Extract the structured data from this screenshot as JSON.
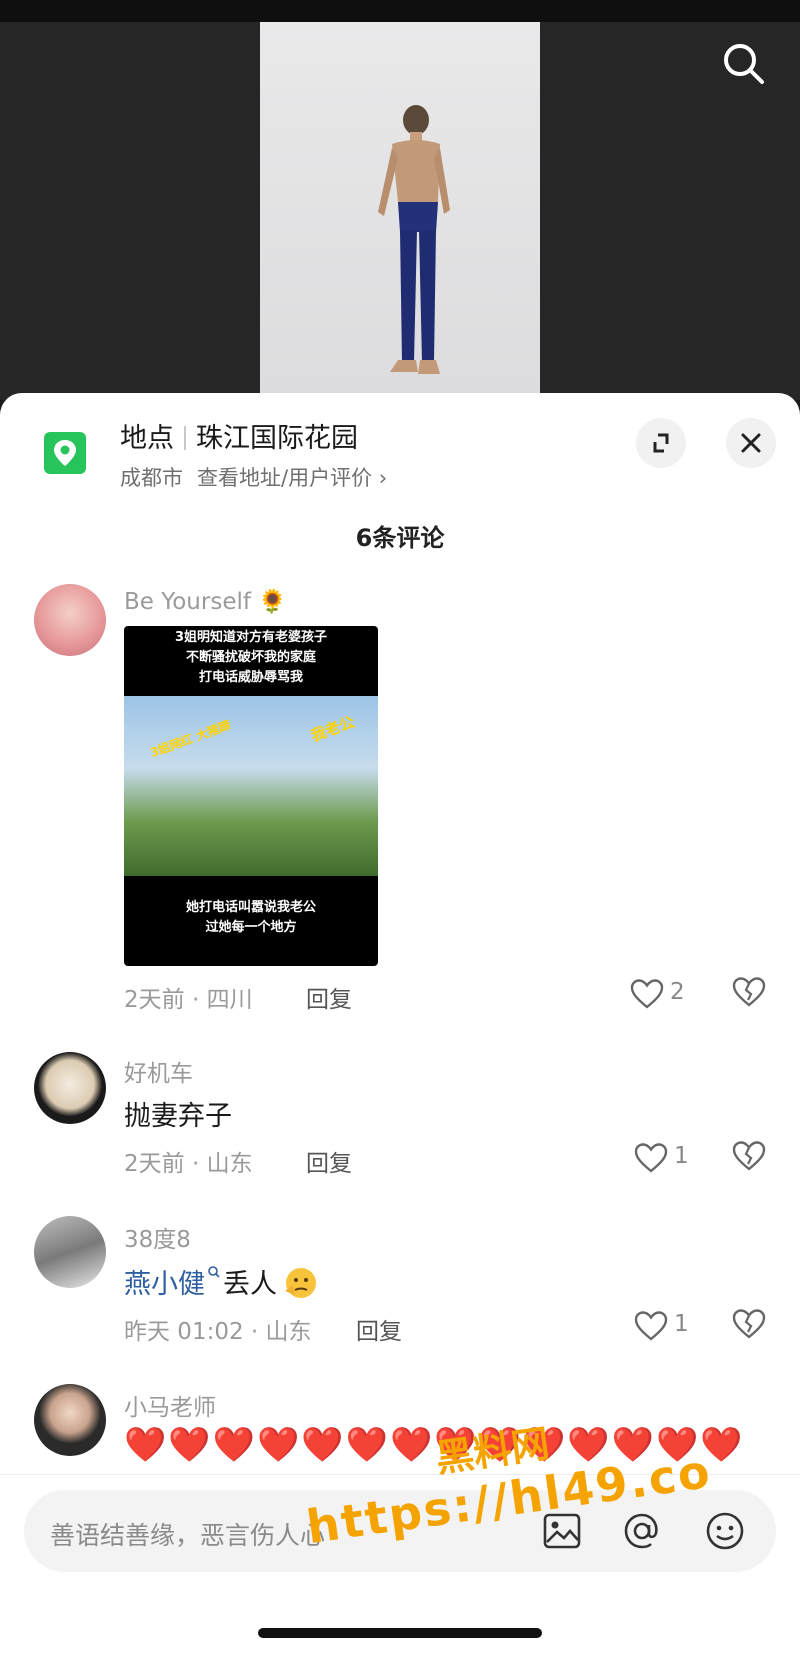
{
  "video": {
    "search_icon": "search-icon"
  },
  "location": {
    "label": "地点",
    "name": "珠江国际花园",
    "city": "成都市",
    "link": "查看地址/用户评价 ›",
    "icon": "location-pin-icon"
  },
  "comments_count": "6条评论",
  "comments": [
    {
      "user": "Be Yourself 🌻",
      "image_caption_top": [
        "3姐明知道对方有老婆孩子",
        "不断骚扰破坏我的家庭",
        "打电话威胁辱骂我"
      ],
      "image_tag": "我老公",
      "image_tag2": "3姐网红 大猪蹄",
      "image_caption_bottom": [
        "她打电话叫嚣说我老公",
        "过她每一个地方"
      ],
      "time_loc": "2天前 · 四川",
      "reply": "回复",
      "likes": "2"
    },
    {
      "user": "好机车",
      "text": "抛妻弃子",
      "time_loc": "2天前 · 山东",
      "reply": "回复",
      "likes": "1"
    },
    {
      "user": "38度8",
      "mention": "燕小健",
      "text": "丢人",
      "time_loc": "昨天 01:02 · 山东",
      "reply": "回复",
      "likes": "1"
    },
    {
      "user": "小马老师",
      "text": "❤️❤️❤️❤️❤️❤️❤️❤️❤️❤️❤️❤️❤️❤️"
    }
  ],
  "input": {
    "placeholder": "善语结善缘，恶言伤人心"
  },
  "watermark": {
    "line1": "黑料网",
    "line2": "https://hl49.co"
  },
  "colors": {
    "accent_green": "#27c35b",
    "heart_red": "#e8203b",
    "watermark": "#f5a300"
  }
}
